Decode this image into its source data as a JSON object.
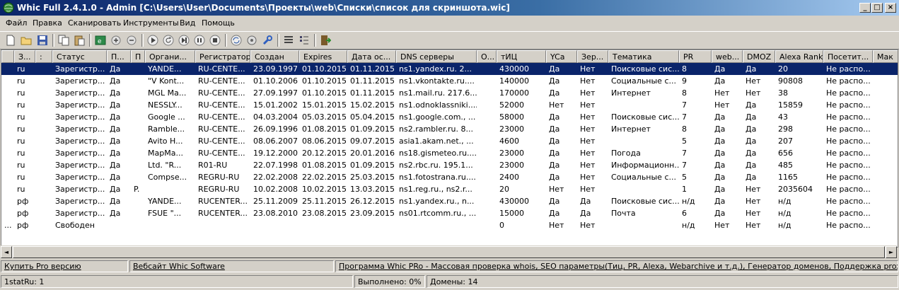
{
  "window": {
    "title": "Whic Full 2.4.1.0 - Admin [C:\\Users\\User\\Documents\\Проекты\\web\\Списки\\список для скриншота.wic]"
  },
  "menu": [
    "Файл",
    "Правка",
    "Сканировать",
    "Инструменты",
    "Вид",
    "Помощь"
  ],
  "toolbar_icons": [
    "new-icon",
    "open-icon",
    "save-icon",
    "copy-icon",
    "paste-icon",
    "export-icon",
    "add-icon",
    "remove-icon",
    "play-icon",
    "replay-icon",
    "next-icon",
    "pause-icon",
    "stop-icon",
    "refresh-icon",
    "settings-icon",
    "wrench-icon",
    "list-icon",
    "details-icon",
    "exit-icon"
  ],
  "table": {
    "columns": [
      "З...",
      ":",
      "Статус",
      "П...",
      "П",
      "Органи...",
      "Регистратор",
      "Создан",
      "Expires",
      "Дата ос...",
      "DNS серверы",
      "О...",
      "тИЦ",
      "YCa",
      "Зер...",
      "Тематика",
      "PR",
      "web...",
      "DMOZ",
      "Alexa Rank",
      "Посетит...",
      "Мак"
    ],
    "rows": [
      [
        "ru",
        "",
        "Зарегистр...",
        "Да",
        "",
        "YANDE...",
        "RU-CENTE...",
        "23.09.1997",
        "01.10.2015",
        "01.11.2015",
        "ns1.yandex.ru. 2...",
        "",
        "430000",
        "Да",
        "Нет",
        "Поисковые сис...",
        "8",
        "Да",
        "Да",
        "20",
        "Не распо...",
        ""
      ],
      [
        "ru",
        "",
        "Зарегистр...",
        "Да",
        "",
        "\"V Kont...",
        "RU-CENTE...",
        "01.10.2006",
        "01.10.2015",
        "01.11.2015",
        "ns1.vkontakte.ru....",
        "",
        "140000",
        "Да",
        "Нет",
        "Социальные с...",
        "9",
        "Да",
        "Нет",
        "90808",
        "Не распо...",
        ""
      ],
      [
        "ru",
        "",
        "Зарегистр...",
        "Да",
        "",
        "MGL Ma...",
        "RU-CENTE...",
        "27.09.1997",
        "01.10.2015",
        "01.11.2015",
        "ns1.mail.ru. 217.6...",
        "",
        "170000",
        "Да",
        "Нет",
        "Интернет",
        "8",
        "Нет",
        "Нет",
        "38",
        "Не распо...",
        ""
      ],
      [
        "ru",
        "",
        "Зарегистр...",
        "Да",
        "",
        "NESSLY...",
        "RU-CENTE...",
        "15.01.2002",
        "15.01.2015",
        "15.02.2015",
        "ns1.odnoklassniki....",
        "",
        "52000",
        "Нет",
        "Нет",
        "",
        "7",
        "Нет",
        "Да",
        "15859",
        "Не распо...",
        ""
      ],
      [
        "ru",
        "",
        "Зарегистр...",
        "Да",
        "",
        "Google ...",
        "RU-CENTE...",
        "04.03.2004",
        "05.03.2015",
        "05.04.2015",
        "ns1.google.com., ...",
        "",
        "58000",
        "Да",
        "Нет",
        "Поисковые сис...",
        "7",
        "Да",
        "Да",
        "43",
        "Не распо...",
        ""
      ],
      [
        "ru",
        "",
        "Зарегистр...",
        "Да",
        "",
        "Ramble...",
        "RU-CENTE...",
        "26.09.1996",
        "01.08.2015",
        "01.09.2015",
        "ns2.rambler.ru. 8...",
        "",
        "23000",
        "Да",
        "Нет",
        "Интернет",
        "8",
        "Да",
        "Да",
        "298",
        "Не распо...",
        ""
      ],
      [
        "ru",
        "",
        "Зарегистр...",
        "Да",
        "",
        "Avito H...",
        "RU-CENTE...",
        "08.06.2007",
        "08.06.2015",
        "09.07.2015",
        "asia1.akam.net., ...",
        "",
        "4600",
        "Да",
        "Нет",
        "",
        "5",
        "Да",
        "Да",
        "207",
        "Не распо...",
        ""
      ],
      [
        "ru",
        "",
        "Зарегистр...",
        "Да",
        "",
        "MapMa...",
        "RU-CENTE...",
        "19.12.2000",
        "20.12.2015",
        "20.01.2016",
        "ns18.gismeteo.ru....",
        "",
        "23000",
        "Да",
        "Нет",
        "Погода",
        "7",
        "Да",
        "Да",
        "656",
        "Не распо...",
        ""
      ],
      [
        "ru",
        "",
        "Зарегистр...",
        "Да",
        "",
        "Ltd. \"R...",
        "R01-RU",
        "22.07.1998",
        "01.08.2015",
        "01.09.2015",
        "ns2.rbc.ru. 195.1...",
        "",
        "23000",
        "Да",
        "Нет",
        "Информационн...",
        "7",
        "Да",
        "Да",
        "485",
        "Не распо...",
        ""
      ],
      [
        "ru",
        "",
        "Зарегистр...",
        "Да",
        "",
        "Compse...",
        "REGRU-RU",
        "22.02.2008",
        "22.02.2015",
        "25.03.2015",
        "ns1.fotostrana.ru....",
        "",
        "2400",
        "Да",
        "Нет",
        "Социальные с...",
        "5",
        "Да",
        "Да",
        "1165",
        "Не распо...",
        ""
      ],
      [
        "ru",
        "",
        "Зарегистр...",
        "Да",
        "P.",
        "",
        "REGRU-RU",
        "10.02.2008",
        "10.02.2015",
        "13.03.2015",
        "ns1.reg.ru., ns2.r...",
        "",
        "20",
        "Нет",
        "Нет",
        "",
        "1",
        "Да",
        "Нет",
        "2035604",
        "Не распо...",
        ""
      ],
      [
        "рф",
        "",
        "Зарегистр...",
        "Да",
        "",
        "YANDE...",
        "RUCENTER...",
        "25.11.2009",
        "25.11.2015",
        "26.12.2015",
        "ns1.yandex.ru., n...",
        "",
        "430000",
        "Да",
        "Да",
        "Поисковые сис...",
        "н/д",
        "Да",
        "Нет",
        "н/д",
        "Не распо...",
        ""
      ],
      [
        "рф",
        "",
        "Зарегистр...",
        "Да",
        "",
        "FSUE \"...",
        "RUCENTER...",
        "23.08.2010",
        "23.08.2015",
        "23.09.2015",
        "ns01.rtcomm.ru., ...",
        "",
        "15000",
        "Да",
        "Да",
        "Почта",
        "6",
        "Да",
        "Нет",
        "н/д",
        "Не распо...",
        ""
      ],
      [
        "рф",
        "",
        "Свободен",
        "",
        "",
        "",
        "",
        "",
        "",
        "",
        "",
        "",
        "0",
        "Нет",
        "Нет",
        "",
        "н/д",
        "Нет",
        "Нет",
        "н/д",
        "Не распо...",
        ""
      ]
    ],
    "selected_row": 0
  },
  "links": {
    "buy_pro": "Купить Pro версию",
    "website": "Вебсайт Whic Software",
    "promo": "Программа Whic PRo - Массовая проверка whois, SEO параметры(Тиц, PR, Alexa, Webarchive и т.д.), Генератор доменов, Поддержка proxy socks, Пере"
  },
  "status": {
    "list": "1statRu: 1",
    "done": "Выполнено: 0%",
    "domains": "Домены: 14"
  },
  "colors": {
    "selection": "#0a246a",
    "titlebar": "#0a246a",
    "face": "#d4d0c8"
  }
}
